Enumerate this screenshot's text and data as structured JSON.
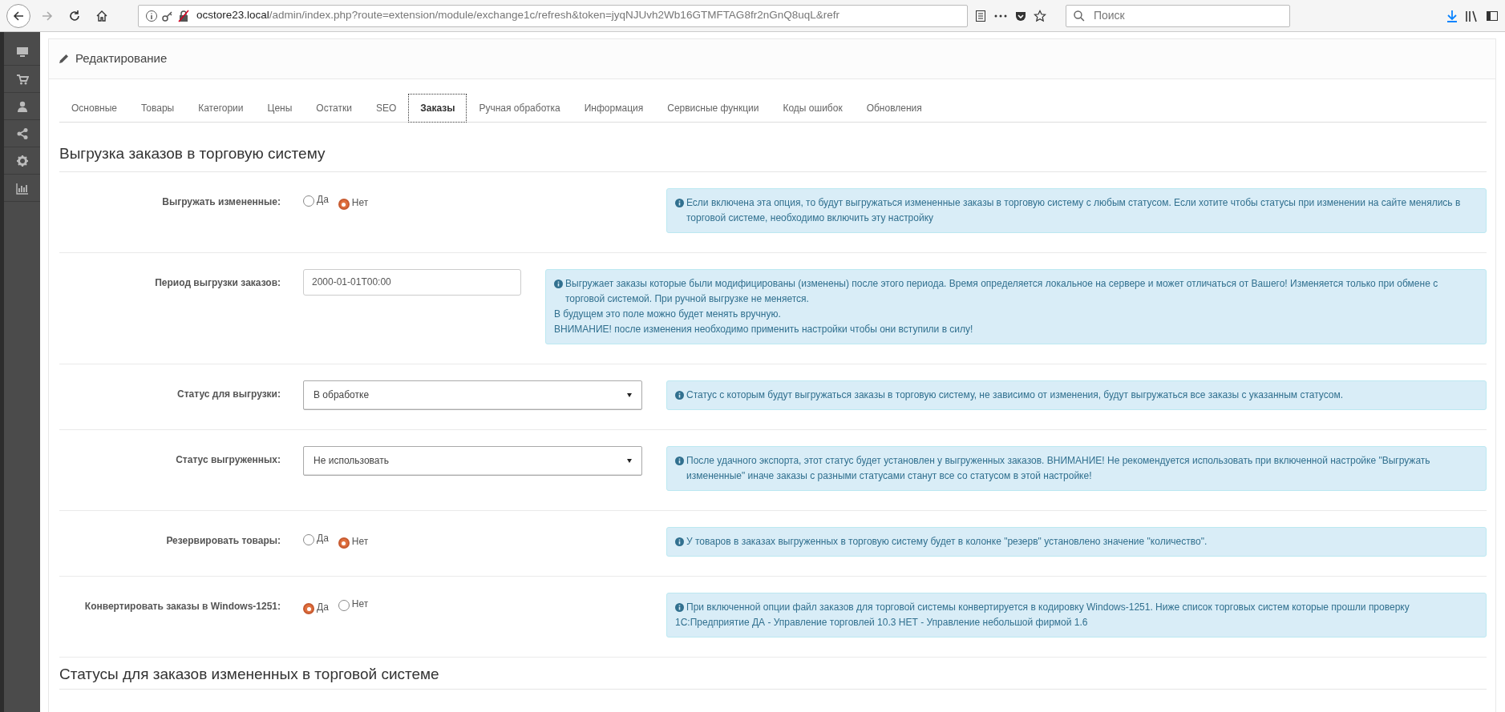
{
  "browser": {
    "url_host": "ocstore23.local",
    "url_path": "/admin/index.php?route=extension/module/exchange1c/refresh&token=jyqNJUvh2Wb16GTMFTAG8fr2nGnQ8uqL&refr",
    "search_placeholder": "Поиск"
  },
  "panel": {
    "title": "Редактирование"
  },
  "tabs": [
    {
      "label": "Основные",
      "selected": false
    },
    {
      "label": "Товары",
      "selected": false
    },
    {
      "label": "Категории",
      "selected": false
    },
    {
      "label": "Цены",
      "selected": false
    },
    {
      "label": "Остатки",
      "selected": false
    },
    {
      "label": "SEO",
      "selected": false
    },
    {
      "label": "Заказы",
      "selected": true
    },
    {
      "label": "Ручная обработка",
      "selected": false
    },
    {
      "label": "Информация",
      "selected": false
    },
    {
      "label": "Сервисные функции",
      "selected": false
    },
    {
      "label": "Коды ошибок",
      "selected": false
    },
    {
      "label": "Обновления",
      "selected": false
    }
  ],
  "section": {
    "heading": "Выгрузка заказов в торговую систему",
    "rows": [
      {
        "kind": "radio",
        "label": "Выгружать измененные:",
        "options": [
          {
            "label": "Да",
            "selected": false
          },
          {
            "label": "Нет",
            "selected": true
          }
        ],
        "info": [
          "Если включена эта опция, то будут выгружаться измененные заказы в торговую систему с любым статусом. Если хотите чтобы статусы при изменении на сайте менялись в торговой системе, необходимо включить эту настройку"
        ]
      },
      {
        "kind": "text",
        "label": "Период выгрузки заказов:",
        "value": "2000-01-01T00:00",
        "info": [
          "Выгружает заказы которые были модифицированы (изменены) после этого периода. Время определяется локальное на сервере и может отличаться от Вашего! Изменяется только при обмене с торговой системой. При ручной выгрузке не меняется.",
          "В будущем это поле можно будет менять вручную.",
          "ВНИМАНИЕ! после изменения необходимо применить настройки чтобы они вступили в силу!"
        ]
      },
      {
        "kind": "select",
        "label": "Статус для выгрузки:",
        "value": "В обработке",
        "info": [
          "Статус с которым будут выгружаться заказы в торговую систему, не зависимо от изменения, будут выгружаться все заказы с указанным статусом."
        ]
      },
      {
        "kind": "select",
        "label": "Статус выгруженных:",
        "value": "Не использовать",
        "info": [
          "После удачного экспорта, этот статус будет установлен у выгруженных заказов. ВНИМАНИЕ! Не рекомендуется использовать при включенной настройке \"Выгружать измененные\" иначе заказы с разными статусами станут все со статусом в этой настройке!"
        ]
      },
      {
        "kind": "radio",
        "label": "Резервировать товары:",
        "options": [
          {
            "label": "Да",
            "selected": false
          },
          {
            "label": "Нет",
            "selected": true
          }
        ],
        "info": [
          "У товаров в заказах выгруженных в торговую систему будет в колонке \"резерв\" установлено значение \"количество\"."
        ]
      },
      {
        "kind": "radio",
        "label": "Конвертировать заказы в Windows-1251:",
        "options": [
          {
            "label": "Да",
            "selected": true
          },
          {
            "label": "Нет",
            "selected": false
          }
        ],
        "info": [
          "При включенной опции файл заказов для торговой системы конвертируется в кодировку Windows-1251. Ниже список торговых систем которые прошли проверку",
          "1С:Предприятие ДА - Управление торговлей 10.3 НЕТ - Управление небольшой фирмой 1.6"
        ]
      }
    ]
  },
  "section2": {
    "heading": "Статусы для заказов измененных в торговой системе"
  }
}
